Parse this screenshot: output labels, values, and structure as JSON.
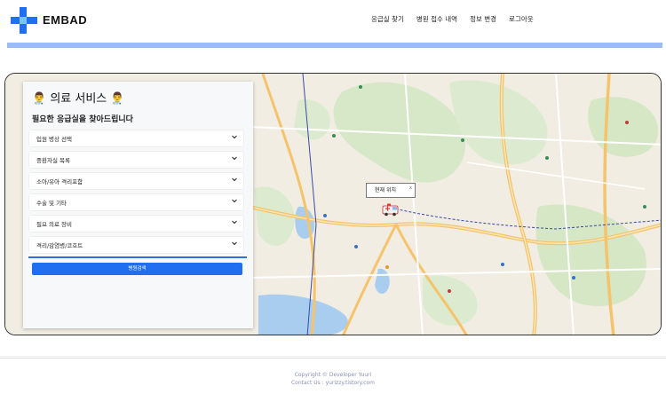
{
  "brand": {
    "name": "EMBAD"
  },
  "nav": {
    "items": [
      "응급실 찾기",
      "병원 접수 내역",
      "정보 변경",
      "로그아웃"
    ]
  },
  "panel": {
    "title": "👨‍⚕️ 의료 서비스 👨‍⚕️",
    "subtitle": "필요한 응급실을 찾아드립니다",
    "dropdowns": [
      "입원 병상 선택",
      "중환자실 목록",
      "소아/유아 격리포함",
      "수술 및 기타",
      "필요 의료 장비",
      "격리/감염병/코호트"
    ],
    "search_button": "병원검색"
  },
  "map": {
    "marker_label": "현재 위치",
    "marker_close": "x"
  },
  "footer": {
    "copyright": "Copyright © Developer Yuuri",
    "contact": "Contact Us : yurizzy.tistory.com"
  },
  "colors": {
    "accent": "#9bbcf6",
    "button": "#1f6ff0",
    "footer_text": "#8891b8"
  },
  "icons": {
    "logo": "medical-cross-icon",
    "marker": "ambulance-icon",
    "dropdown": "chevron-down-icon"
  }
}
